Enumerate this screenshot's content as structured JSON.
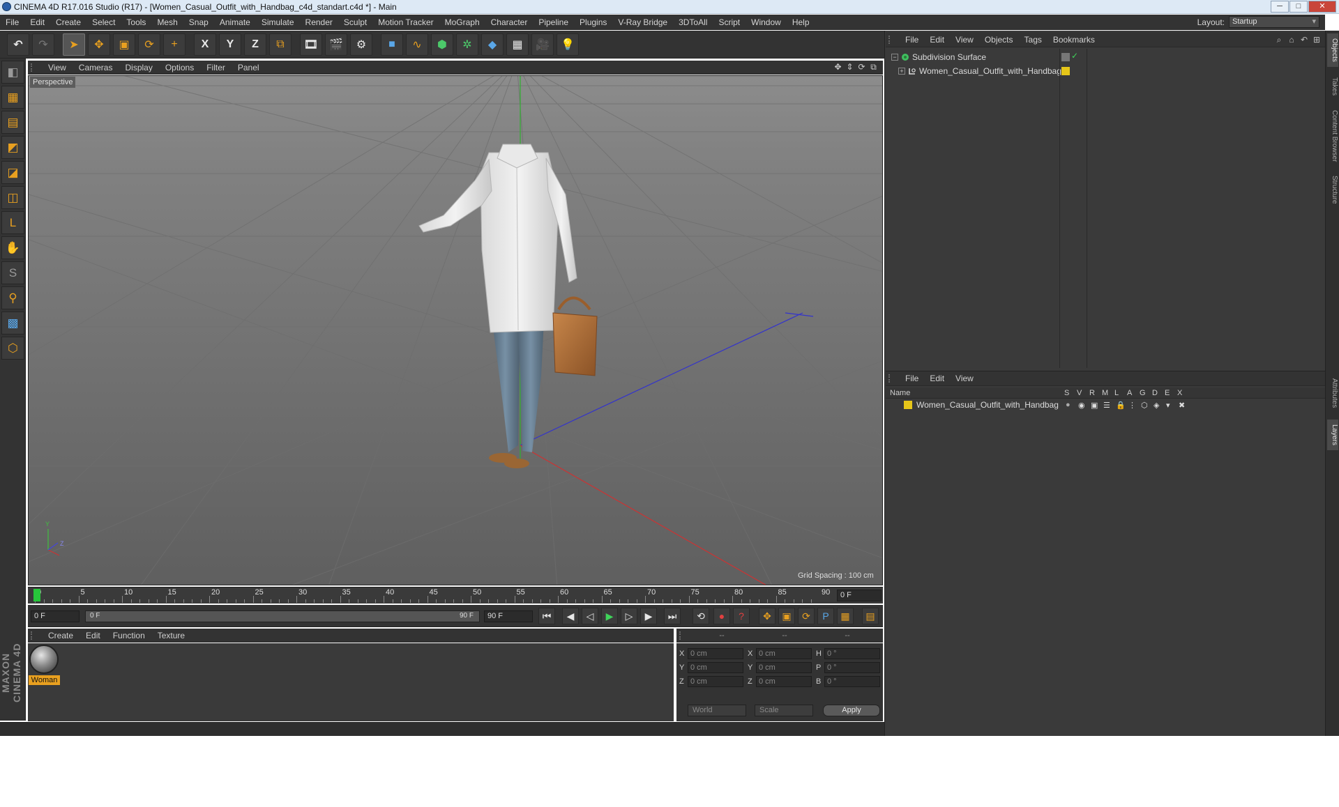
{
  "window": {
    "title": "CINEMA 4D R17.016 Studio (R17) - [Women_Casual_Outfit_with_Handbag_c4d_standart.c4d *] - Main",
    "min": "─",
    "max": "□",
    "close": "✕"
  },
  "menu": [
    "File",
    "Edit",
    "Create",
    "Select",
    "Tools",
    "Mesh",
    "Snap",
    "Animate",
    "Simulate",
    "Render",
    "Sculpt",
    "Motion Tracker",
    "MoGraph",
    "Character",
    "Pipeline",
    "Plugins",
    "V-Ray Bridge",
    "3DToAll",
    "Script",
    "Window",
    "Help"
  ],
  "layout": {
    "label": "Layout:",
    "value": "Startup"
  },
  "toolbar": {
    "undo": "↶",
    "redo": "↷",
    "select": "➤",
    "move": "✥",
    "scale": "▣",
    "rotate": "⟳",
    "multi": "+",
    "x": "X",
    "y": "Y",
    "z": "Z",
    "coord": "⧉",
    "render_view": "🎞",
    "render_pic": "🎬",
    "render_settings": "⚙",
    "cube": "■",
    "spline": "∿",
    "nurbs": "⬢",
    "mograph": "✲",
    "deformer": "◆",
    "scene": "▦",
    "camera": "🎥",
    "light": "💡"
  },
  "left_tools": [
    "◧",
    "▦",
    "▤",
    "◩",
    "◪",
    "◫",
    "L",
    "✋",
    "S",
    "⚲",
    "▩",
    "⬡"
  ],
  "maxon_logo": "MAXON CINEMA 4D",
  "viewport": {
    "menu": [
      "View",
      "Cameras",
      "Display",
      "Options",
      "Filter",
      "Panel"
    ],
    "nav": [
      "✥",
      "⇕",
      "⟳",
      "⧉"
    ],
    "label": "Perspective",
    "grid_spacing": "Grid Spacing : 100 cm",
    "axis_y": "Y",
    "axis_z": "Z"
  },
  "timeline": {
    "ticks": [
      "0",
      "5",
      "10",
      "15",
      "20",
      "25",
      "30",
      "35",
      "40",
      "45",
      "50",
      "55",
      "60",
      "65",
      "70",
      "75",
      "80",
      "85",
      "90"
    ],
    "current_frame": "0 F"
  },
  "transport": {
    "start": "0 F",
    "range_start": "0 F",
    "range_end": "90 F",
    "end": "90 F",
    "buttons": {
      "first": "⏮",
      "prev_key": "◀",
      "prev_frame": "◁",
      "play": "▶",
      "next_frame": "▷",
      "next_key": "▶",
      "last": "⏭"
    },
    "extra": {
      "loop": "⟲",
      "record": "●",
      "auto": "?",
      "move": "✥",
      "scale": "▣",
      "rot": "⟳",
      "param": "P",
      "pla": "▦",
      "film": "▤"
    }
  },
  "material": {
    "menu": [
      "Create",
      "Edit",
      "Function",
      "Texture"
    ],
    "name": "Woman"
  },
  "coords": {
    "headers": [
      "--",
      "--",
      "--"
    ],
    "rows": [
      {
        "a": "X",
        "av": "0 cm",
        "b": "X",
        "bv": "0 cm",
        "c": "H",
        "cv": "0 °"
      },
      {
        "a": "Y",
        "av": "0 cm",
        "b": "Y",
        "bv": "0 cm",
        "c": "P",
        "cv": "0 °"
      },
      {
        "a": "Z",
        "av": "0 cm",
        "b": "Z",
        "bv": "0 cm",
        "c": "B",
        "cv": "0 °"
      }
    ],
    "world": "World",
    "scale": "Scale",
    "apply": "Apply"
  },
  "object_manager": {
    "menu": [
      "File",
      "Edit",
      "View",
      "Objects",
      "Tags",
      "Bookmarks"
    ],
    "icons": [
      "⌕",
      "⌂",
      "↶",
      "⊞"
    ],
    "items": [
      {
        "name": "Subdivision Surface",
        "expand": "−"
      },
      {
        "name": "Women_Casual_Outfit_with_Handbag",
        "expand": "+"
      }
    ],
    "check": "✓"
  },
  "layer_manager": {
    "menu": [
      "File",
      "Edit",
      "View"
    ],
    "columns": [
      "Name",
      "S",
      "V",
      "R",
      "M",
      "L",
      "A",
      "G",
      "D",
      "E",
      "X"
    ],
    "layer": "Women_Casual_Outfit_with_Handbag",
    "layer_color": "#e6c619"
  },
  "side_tabs": [
    "Objects",
    "Takes",
    "Content Browser",
    "Structure",
    "Attributes",
    "Layers"
  ],
  "colors": {
    "accent": "#e8a020",
    "playhead": "#27c73b"
  }
}
